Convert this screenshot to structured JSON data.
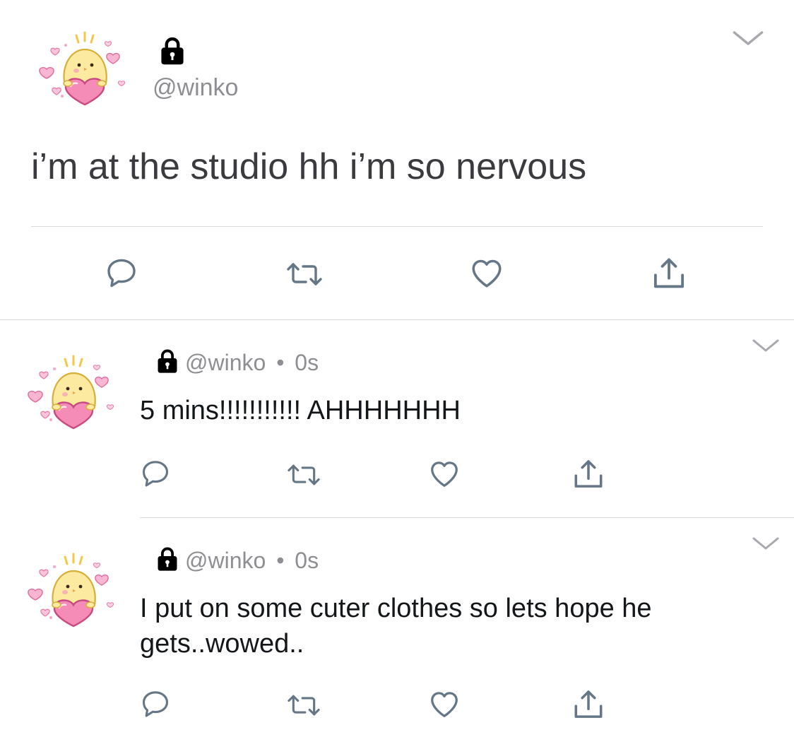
{
  "main_tweet": {
    "handle": "@winko",
    "text": "i’m at the studio hh i’m so nervous",
    "locked": true
  },
  "replies": [
    {
      "handle": "@winko",
      "separator": "•",
      "time": "0s",
      "text": "5 mins!!!!!!!!!!! AHHHHHHH",
      "locked": true
    },
    {
      "handle": "@winko",
      "separator": "•",
      "time": "0s",
      "text": "I put on some cuter clothes so lets hope he gets..wowed..",
      "locked": true
    }
  ],
  "icons": {
    "reply": "speech-bubble-icon",
    "retweet": "retweet-icon",
    "like": "heart-icon",
    "share": "share-icon",
    "lock": "lock-icon",
    "menu": "chevron-down-icon",
    "avatar": "chick-with-heart-avatar"
  },
  "colors": {
    "action_icon": "#657786",
    "secondary_text": "#8e8e93",
    "divider": "#d9d9d9",
    "avatar_heart": "#f58cb8",
    "avatar_chick": "#fbeaa0"
  }
}
